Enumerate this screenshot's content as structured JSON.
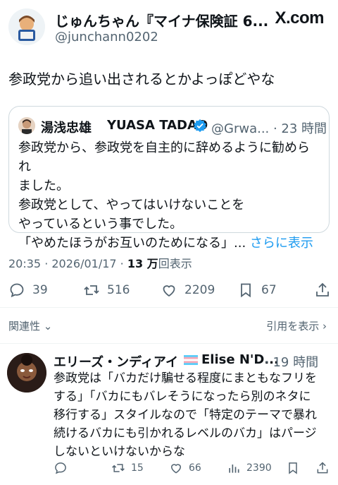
{
  "post": {
    "display_name": "じゅんちゃん『マイナ保険証 6...",
    "handle": "@junchann0202",
    "site": "X.com",
    "text": "参政党から追い出されるとかよっぽどやな"
  },
  "quote": {
    "name_jp": "湯浅忠雄",
    "name_en": "YUASA TADAO",
    "handle_time": "@Grwa... · 23 時間",
    "lines": [
      "参政党から、参政党を自主的に辞めるように勧められ",
      "ました。",
      "参政党として、やってはいけないことを",
      "やっているという事でした。",
      "「やめたほうがお互いのためになる」..."
    ],
    "more": "さらに表示"
  },
  "meta": {
    "datetime": "20:35 · 2026/01/17 · ",
    "views_count": "13 万",
    "views_label": "回表示"
  },
  "actions": {
    "replies": "39",
    "reposts": "516",
    "likes": "2209",
    "bookmarks": "67"
  },
  "related": {
    "label": "関連性",
    "quotes_link": "引用を表示"
  },
  "reply": {
    "name": "エリーズ・ンディアイ",
    "name2": "Elise N'D...",
    "time": "· 19 時間",
    "lines": [
      "参政党は「バカだけ騙せる程度にまともなフリを",
      "する」「バカにもバレそうになったら別のネタに",
      "移行する」スタイルなので「特定のテーマで暴れ",
      "続けるバカにも引かれるレベルのバカ」はパージ",
      "しないといけないからな"
    ],
    "reposts": "15",
    "likes": "66",
    "views": "2390"
  },
  "colors": {
    "text": "#0f1419",
    "muted": "#536471",
    "link": "#1d9bf0",
    "border": "#cfd9de"
  }
}
